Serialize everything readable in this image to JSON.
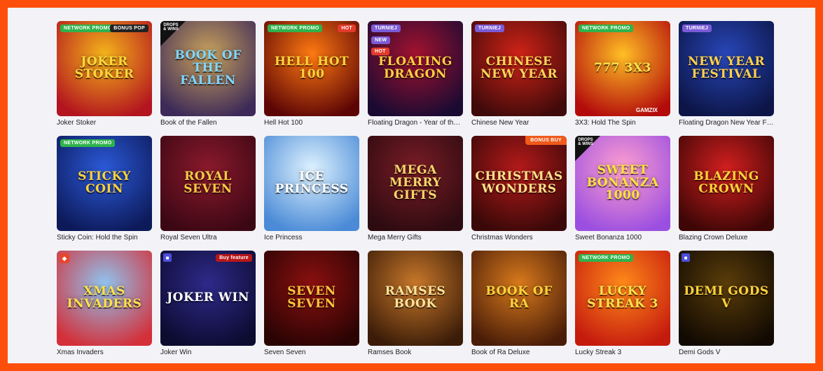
{
  "games": [
    {
      "label": "Joker Stoker",
      "art_title": "Joker Stoker",
      "badge": "NETWORK PROMO",
      "badge_color": "green",
      "colors": [
        "#f4b41a",
        "#b3141f"
      ],
      "text_color": "#ffd83a",
      "extra": "BONUS POP"
    },
    {
      "label": "Book of the Fallen",
      "art_title": "Book of the Fallen",
      "corner": "DROPS & WINS",
      "colors": [
        "#c9a25c",
        "#3d2a58"
      ],
      "text_color": "#7ed6ff"
    },
    {
      "label": "Hell Hot 100",
      "art_title": "Hell Hot 100",
      "badge": "NETWORK PROMO",
      "badge_color": "green",
      "colors": [
        "#ff7a12",
        "#5d0505"
      ],
      "text_color": "#ffd23a",
      "extra": "HOT"
    },
    {
      "label": "Floating Dragon - Year of the Snake",
      "art_title": "Floating Dragon",
      "badge": "TURNIEJ",
      "badge_color": "purple",
      "badge_new": "NEW",
      "badge_hot": "HOT",
      "colors": [
        "#a3122f",
        "#1a0a32"
      ],
      "text_color": "#ffcf3e"
    },
    {
      "label": "Chinese New Year",
      "art_title": "Chinese New Year",
      "badge": "TURNIEJ",
      "badge_color": "purple",
      "colors": [
        "#d02317",
        "#400a0a"
      ],
      "text_color": "#ffd45a"
    },
    {
      "label": "3X3: Hold The Spin",
      "art_title": "777 3x3",
      "badge": "NETWORK PROMO",
      "badge_color": "green",
      "colors": [
        "#ffbf24",
        "#b30b0b"
      ],
      "text_color": "#ffe24a",
      "extra": "GAMZIX"
    },
    {
      "label": "Floating Dragon New Year Festival",
      "art_title": "New Year Festival",
      "badge": "TURNIEJ",
      "badge_color": "purple",
      "colors": [
        "#2846b8",
        "#0c1546"
      ],
      "text_color": "#ffd14a"
    },
    {
      "label": "Sticky Coin: Hold the Spin",
      "art_title": "Sticky Coin",
      "badge": "NETWORK PROMO",
      "badge_color": "green",
      "colors": [
        "#2b5ad9",
        "#0d1a5a"
      ],
      "text_color": "#ffd23a"
    },
    {
      "label": "Royal Seven Ultra",
      "art_title": "Royal Seven",
      "colors": [
        "#8a1a2c",
        "#3c0714"
      ],
      "text_color": "#f5c945"
    },
    {
      "label": "Ice Princess",
      "art_title": "Ice Princess",
      "colors": [
        "#dff3ff",
        "#4a8ad6"
      ],
      "text_color": "#ffffff"
    },
    {
      "label": "Mega Merry Gifts",
      "art_title": "Mega Merry Gifts",
      "colors": [
        "#7a1c26",
        "#2d0b10"
      ],
      "text_color": "#f7d66a"
    },
    {
      "label": "Christmas Wonders",
      "art_title": "Christmas Wonders",
      "badge": "BONUS BUY",
      "badge_color": "orange",
      "colors": [
        "#b51a1a",
        "#3a0808"
      ],
      "text_color": "#ffe08a"
    },
    {
      "label": "Sweet Bonanza 1000",
      "art_title": "Sweet Bonanza 1000",
      "corner": "DROPS & WINS",
      "colors": [
        "#ff9fd0",
        "#9b4fe0"
      ],
      "text_color": "#ffe23a"
    },
    {
      "label": "Blazing Crown Deluxe",
      "art_title": "Blazing Crown",
      "colors": [
        "#d31f1f",
        "#3e0606"
      ],
      "text_color": "#ffd23a"
    },
    {
      "label": "Xmas Invaders",
      "art_title": "Xmas Invaders",
      "colors": [
        "#8fc4f0",
        "#d3303a"
      ],
      "text_color": "#ffe04a"
    },
    {
      "label": "Joker Win",
      "art_title": "Joker Win",
      "colors": [
        "#2e2a8a",
        "#0c0b30"
      ],
      "text_color": "#ffffff",
      "extra": "Buy feature"
    },
    {
      "label": "Seven Seven",
      "art_title": "Seven Seven",
      "colors": [
        "#8b1010",
        "#2a0303"
      ],
      "text_color": "#ffc23a"
    },
    {
      "label": "Ramses Book",
      "art_title": "Ramses Book",
      "colors": [
        "#c8782a",
        "#3b1c08"
      ],
      "text_color": "#ffe39a"
    },
    {
      "label": "Book of Ra Deluxe",
      "art_title": "Book of Ra",
      "colors": [
        "#d97a1c",
        "#4a1d08"
      ],
      "text_color": "#ffd23a"
    },
    {
      "label": "Lucky Streak 3",
      "art_title": "Lucky Streak 3",
      "badge": "NETWORK PROMO",
      "badge_color": "green",
      "colors": [
        "#ff8a1a",
        "#c51a0e"
      ],
      "text_color": "#ffe24a"
    },
    {
      "label": "Demi Gods V",
      "art_title": "Demi Gods V",
      "colors": [
        "#5a3d0a",
        "#120a02"
      ],
      "text_color": "#ffd23a"
    }
  ]
}
